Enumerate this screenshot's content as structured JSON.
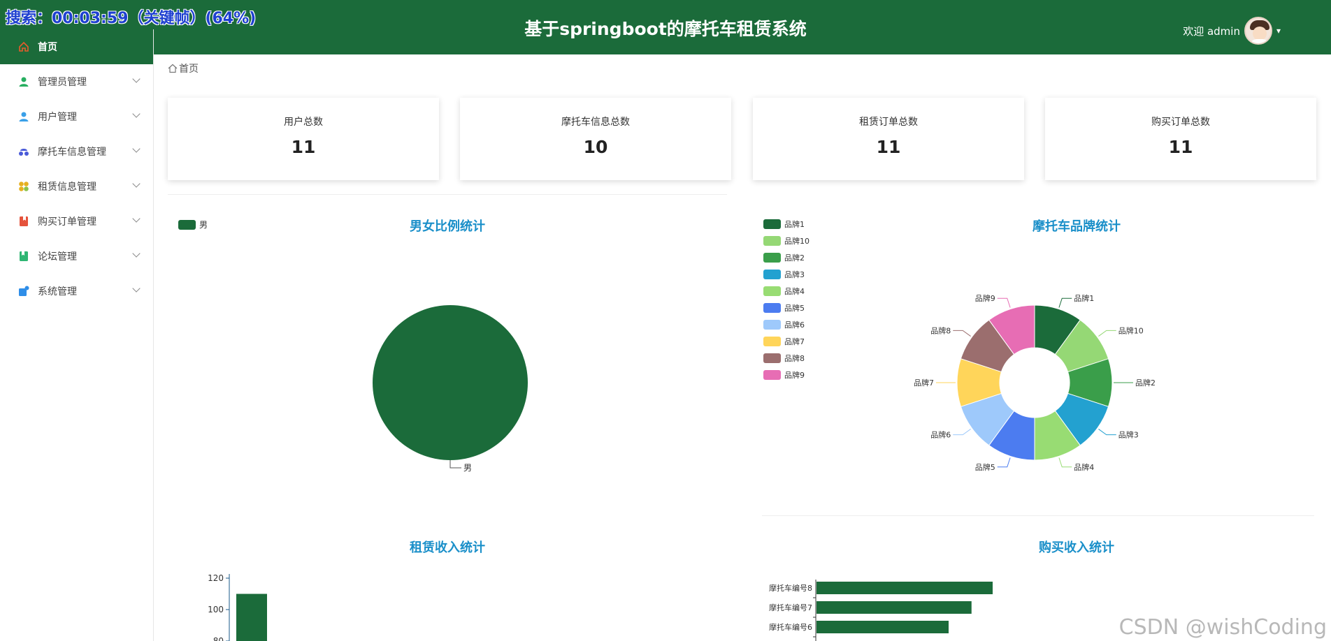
{
  "overlay": "搜索：00:03:59（关键帧）(64%)",
  "header": {
    "title": "基于springboot的摩托车租赁系统",
    "welcome": "欢迎 admin"
  },
  "sidebar": {
    "items": [
      {
        "label": "首页",
        "icon": "home-icon",
        "color": "#e65c2c",
        "active": true
      },
      {
        "label": "管理员管理",
        "icon": "admin-user-icon",
        "color": "#27ae60"
      },
      {
        "label": "用户管理",
        "icon": "user-icon",
        "color": "#3aa0e8"
      },
      {
        "label": "摩托车信息管理",
        "icon": "motorcycle-icon",
        "color": "#4a5bd8"
      },
      {
        "label": "租赁信息管理",
        "icon": "lease-icon",
        "color": "#e6b020"
      },
      {
        "label": "购买订单管理",
        "icon": "order-icon",
        "color": "#e5533c"
      },
      {
        "label": "论坛管理",
        "icon": "forum-icon",
        "color": "#2fb673"
      },
      {
        "label": "系统管理",
        "icon": "system-icon",
        "color": "#2f8ee8"
      }
    ]
  },
  "breadcrumb": {
    "label": "首页"
  },
  "stats": [
    {
      "label": "用户总数",
      "value": "11"
    },
    {
      "label": "摩托车信息总数",
      "value": "10"
    },
    {
      "label": "租赁订单总数",
      "value": "11"
    },
    {
      "label": "购买订单总数",
      "value": "11"
    }
  ],
  "gender_chart": {
    "title": "男女比例统计",
    "chart_data": {
      "type": "pie",
      "categories": [
        "男"
      ],
      "values": [
        1
      ],
      "colors": [
        "#1b6b3a"
      ]
    },
    "legend": "男",
    "slice_label": "男"
  },
  "brand_chart": {
    "title": "摩托车品牌统计",
    "chart_data": {
      "type": "pie",
      "categories": [
        "品牌1",
        "品牌10",
        "品牌2",
        "品牌3",
        "品牌4",
        "品牌5",
        "品牌6",
        "品牌7",
        "品牌8",
        "品牌9"
      ],
      "values": [
        1,
        1,
        1,
        1,
        1,
        1,
        1,
        1,
        1,
        1
      ],
      "colors": [
        "#1b6b3a",
        "#95d875",
        "#3a9e4a",
        "#23a1d0",
        "#98dc73",
        "#4c7cf0",
        "#9ec9fb",
        "#ffd55a",
        "#9b6e6e",
        "#e76db4"
      ]
    }
  },
  "lease_chart": {
    "title": "租赁收入统计",
    "chart_data": {
      "type": "bar",
      "y_ticks": [
        120,
        100,
        80
      ],
      "first_bar_value": 110
    }
  },
  "purchase_chart": {
    "title": "购买收入统计",
    "chart_data": {
      "type": "bar",
      "categories": [
        "摩托车编号8",
        "摩托车编号7",
        "摩托车编号6"
      ],
      "values": [
        100,
        88,
        75
      ]
    }
  },
  "watermark": "CSDN @wishCoding"
}
